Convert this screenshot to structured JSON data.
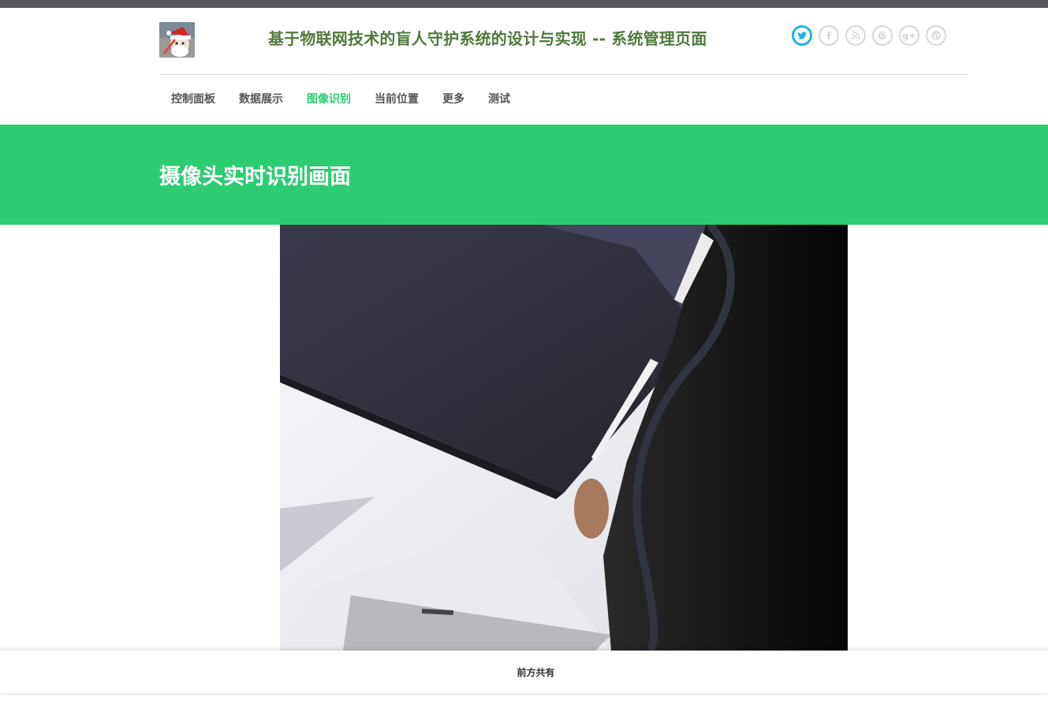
{
  "header": {
    "site_title": "基于物联网技术的盲人守护系统的设计与实现 -- 系统管理页面",
    "social_icons": [
      {
        "name": "twitter-icon",
        "glyph": "t",
        "active": true
      },
      {
        "name": "facebook-icon",
        "glyph": "f",
        "active": false
      },
      {
        "name": "rss-icon",
        "glyph": "rss",
        "active": false
      },
      {
        "name": "pinterest-icon",
        "glyph": "p",
        "active": false
      },
      {
        "name": "google-plus-icon",
        "glyph": "g+",
        "active": false
      },
      {
        "name": "dribbble-icon",
        "glyph": "dribbble",
        "active": false
      }
    ],
    "accent_color": "#1fb3e6"
  },
  "nav": {
    "items": [
      {
        "label": "控制面板"
      },
      {
        "label": "数据展示"
      },
      {
        "label": "图像识别"
      },
      {
        "label": "当前位置"
      },
      {
        "label": "更多"
      },
      {
        "label": "测试"
      }
    ],
    "active_index": 2,
    "active_color": "#2ecc71"
  },
  "banner": {
    "title": "摄像头实时识别画面",
    "color": "#2ecc71"
  },
  "footer": {
    "text": "前方共有"
  }
}
